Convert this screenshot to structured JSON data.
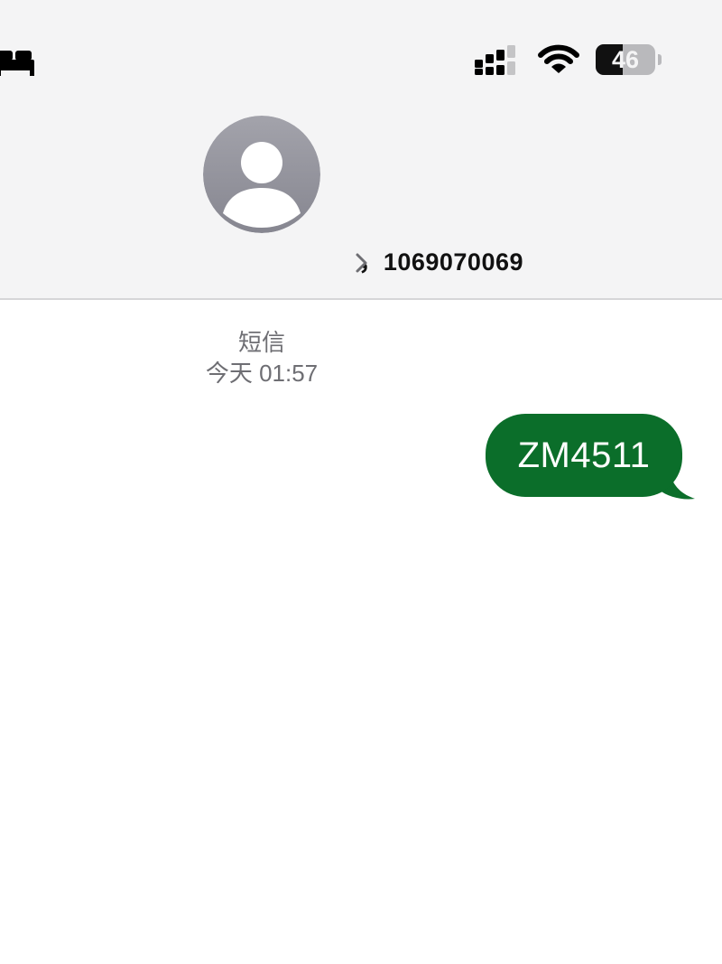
{
  "status_bar": {
    "focus_icon": "bed-icon",
    "signal_icon": "cellular-signal-icon",
    "wifi_icon": "wifi-icon",
    "battery_level": "46",
    "battery_fraction": 0.46
  },
  "contact": {
    "avatar_icon": "person-placeholder-icon",
    "name": "，1069070069",
    "chevron_icon": "chevron-right-icon"
  },
  "thread": {
    "service": "短信",
    "timestamp": "今天 01:57",
    "messages": [
      {
        "direction": "outgoing",
        "text": "ZM4511"
      }
    ]
  },
  "colors": {
    "header_bg": "#f4f4f5",
    "outgoing_bubble": "#0b6e2a",
    "meta_text": "#6e6e73",
    "avatar_bg": "#8e8e96"
  }
}
